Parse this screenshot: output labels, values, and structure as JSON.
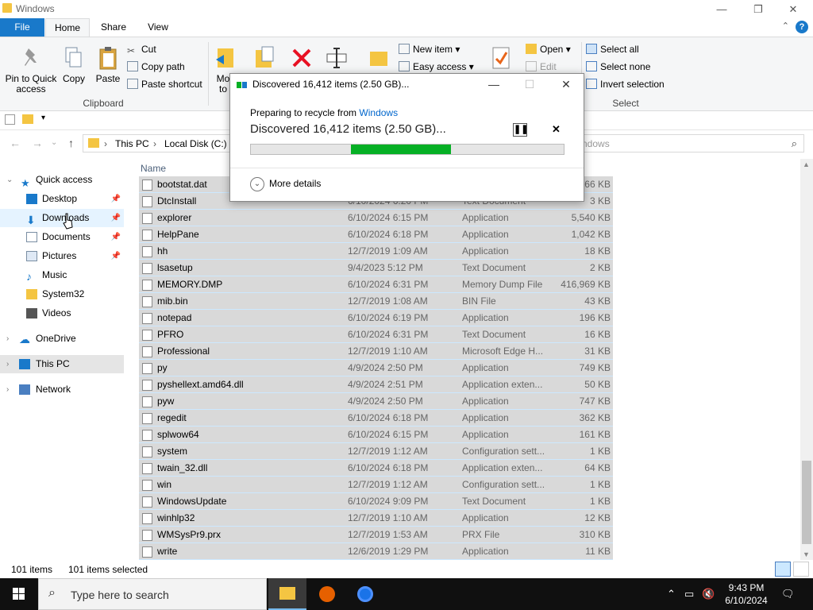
{
  "window": {
    "title": "Windows"
  },
  "tabs": {
    "file": "File",
    "home": "Home",
    "share": "Share",
    "view": "View"
  },
  "ribbon": {
    "pin_label": "Pin to Quick access",
    "copy_label": "Copy",
    "paste_label": "Paste",
    "cut_label": "Cut",
    "copy_path_label": "Copy path",
    "paste_shortcut_label": "Paste shortcut",
    "clipboard_group": "Clipboard",
    "move_to_label": "Mo to",
    "new_item_label": "New item",
    "easy_access_label": "Easy access",
    "open_label": "Open",
    "edit_label": "Edit",
    "select_all_label": "Select all",
    "select_none_label": "Select none",
    "invert_selection_label": "Invert selection",
    "select_group": "Select"
  },
  "address": {
    "this_pc": "This PC",
    "local_disk": "Local Disk (C:)",
    "search_tail": "ndows"
  },
  "nav": {
    "quick_access": "Quick access",
    "items": [
      {
        "label": "Desktop"
      },
      {
        "label": "Downloads"
      },
      {
        "label": "Documents"
      },
      {
        "label": "Pictures"
      },
      {
        "label": "Music"
      },
      {
        "label": "System32"
      },
      {
        "label": "Videos"
      }
    ],
    "onedrive": "OneDrive",
    "this_pc": "This PC",
    "network": "Network"
  },
  "filelist": {
    "col_name": "Name",
    "files": [
      {
        "name": "bootstat.dat",
        "date": "",
        "type": "",
        "size": "66 KB"
      },
      {
        "name": "DtcInstall",
        "date": "6/10/2024 6:20 PM",
        "type": "Text Document",
        "size": "3 KB"
      },
      {
        "name": "explorer",
        "date": "6/10/2024 6:15 PM",
        "type": "Application",
        "size": "5,540 KB"
      },
      {
        "name": "HelpPane",
        "date": "6/10/2024 6:18 PM",
        "type": "Application",
        "size": "1,042 KB"
      },
      {
        "name": "hh",
        "date": "12/7/2019 1:09 AM",
        "type": "Application",
        "size": "18 KB"
      },
      {
        "name": "lsasetup",
        "date": "9/4/2023 5:12 PM",
        "type": "Text Document",
        "size": "2 KB"
      },
      {
        "name": "MEMORY.DMP",
        "date": "6/10/2024 6:31 PM",
        "type": "Memory Dump File",
        "size": "416,969 KB"
      },
      {
        "name": "mib.bin",
        "date": "12/7/2019 1:08 AM",
        "type": "BIN File",
        "size": "43 KB"
      },
      {
        "name": "notepad",
        "date": "6/10/2024 6:19 PM",
        "type": "Application",
        "size": "196 KB"
      },
      {
        "name": "PFRO",
        "date": "6/10/2024 6:31 PM",
        "type": "Text Document",
        "size": "16 KB"
      },
      {
        "name": "Professional",
        "date": "12/7/2019 1:10 AM",
        "type": "Microsoft Edge H...",
        "size": "31 KB"
      },
      {
        "name": "py",
        "date": "4/9/2024 2:50 PM",
        "type": "Application",
        "size": "749 KB"
      },
      {
        "name": "pyshellext.amd64.dll",
        "date": "4/9/2024 2:51 PM",
        "type": "Application exten...",
        "size": "50 KB"
      },
      {
        "name": "pyw",
        "date": "4/9/2024 2:50 PM",
        "type": "Application",
        "size": "747 KB"
      },
      {
        "name": "regedit",
        "date": "6/10/2024 6:18 PM",
        "type": "Application",
        "size": "362 KB"
      },
      {
        "name": "splwow64",
        "date": "6/10/2024 6:15 PM",
        "type": "Application",
        "size": "161 KB"
      },
      {
        "name": "system",
        "date": "12/7/2019 1:12 AM",
        "type": "Configuration sett...",
        "size": "1 KB"
      },
      {
        "name": "twain_32.dll",
        "date": "6/10/2024 6:18 PM",
        "type": "Application exten...",
        "size": "64 KB"
      },
      {
        "name": "win",
        "date": "12/7/2019 1:12 AM",
        "type": "Configuration sett...",
        "size": "1 KB"
      },
      {
        "name": "WindowsUpdate",
        "date": "6/10/2024 9:09 PM",
        "type": "Text Document",
        "size": "1 KB"
      },
      {
        "name": "winhlp32",
        "date": "12/7/2019 1:10 AM",
        "type": "Application",
        "size": "12 KB"
      },
      {
        "name": "WMSysPr9.prx",
        "date": "12/7/2019 1:53 AM",
        "type": "PRX File",
        "size": "310 KB"
      },
      {
        "name": "write",
        "date": "12/6/2019 1:29 PM",
        "type": "Application",
        "size": "11 KB"
      }
    ]
  },
  "status": {
    "items": "101 items",
    "selected": "101 items selected"
  },
  "dialog": {
    "title": "Discovered 16,412 items (2.50 GB)...",
    "preparing_prefix": "Preparing to recycle from",
    "preparing_link": "Windows",
    "discovered": "Discovered 16,412 items (2.50 GB)...",
    "more_details": "More details",
    "progress_start": 0.32,
    "progress_end": 0.64,
    "progress_color": "#06b025"
  },
  "taskbar": {
    "search_placeholder": "Type here to search",
    "time": "9:43 PM",
    "date": "6/10/2024"
  },
  "colors": {
    "accent": "#1979ca",
    "selection": "#d9d9d9",
    "taskbar": "#101010"
  }
}
